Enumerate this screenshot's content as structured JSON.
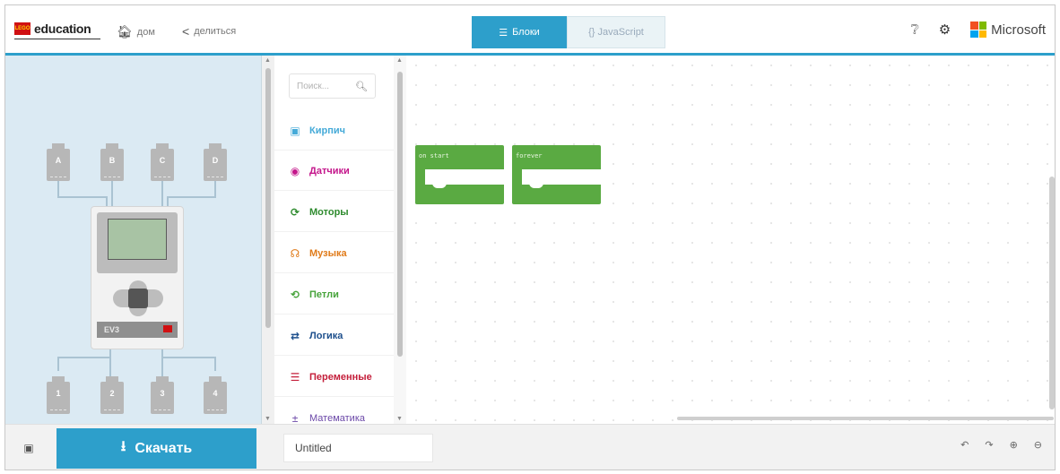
{
  "header": {
    "lego_badge": "LEGO",
    "brand": "education",
    "home_icon": "home-icon",
    "home_label": "дом",
    "share_icon": "share-icon",
    "share_label": "делиться",
    "tabs": [
      {
        "label": "Блоки",
        "icon": "blocks-icon",
        "active": true
      },
      {
        "label": "{} JavaScript",
        "active": false
      }
    ],
    "help_icon": "help-icon",
    "settings_icon": "gear-icon",
    "microsoft_label": "Microsoft",
    "accent_color": "#2d9fcb"
  },
  "simulator": {
    "top_ports": [
      "A",
      "B",
      "C",
      "D"
    ],
    "bottom_ports": [
      "1",
      "2",
      "3",
      "4"
    ],
    "brick_label": "EV3"
  },
  "toolbox": {
    "search_placeholder": "Поиск...",
    "categories": [
      {
        "label": "Кирпич",
        "color": "#45aad8",
        "icon": "brick-icon"
      },
      {
        "label": "Датчики",
        "color": "#c4168b",
        "icon": "sensor-icon"
      },
      {
        "label": "Моторы",
        "color": "#2e8b2e",
        "icon": "motor-icon"
      },
      {
        "label": "Музыка",
        "color": "#e07b1a",
        "icon": "headphones-icon"
      },
      {
        "label": "Петли",
        "color": "#46a33a",
        "icon": "loop-icon"
      },
      {
        "label": "Логика",
        "color": "#1d4f8c",
        "icon": "shuffle-icon"
      },
      {
        "label": "Переменные",
        "color": "#c41e3a",
        "icon": "variables-icon"
      },
      {
        "label": "Математика",
        "color": "#6b48a8",
        "icon": "math-icon"
      }
    ]
  },
  "workspace": {
    "blocks": [
      {
        "label": "on start",
        "color": "#5aaa42"
      },
      {
        "label": "forever",
        "color": "#5aaa42"
      }
    ]
  },
  "bottom": {
    "collapse_icon": "collapse-icon",
    "download_label": "Скачать",
    "download_icon": "download-icon",
    "project_name": "Untitled",
    "controls": [
      "undo-icon",
      "redo-icon",
      "zoom-in-icon",
      "zoom-out-icon"
    ]
  }
}
